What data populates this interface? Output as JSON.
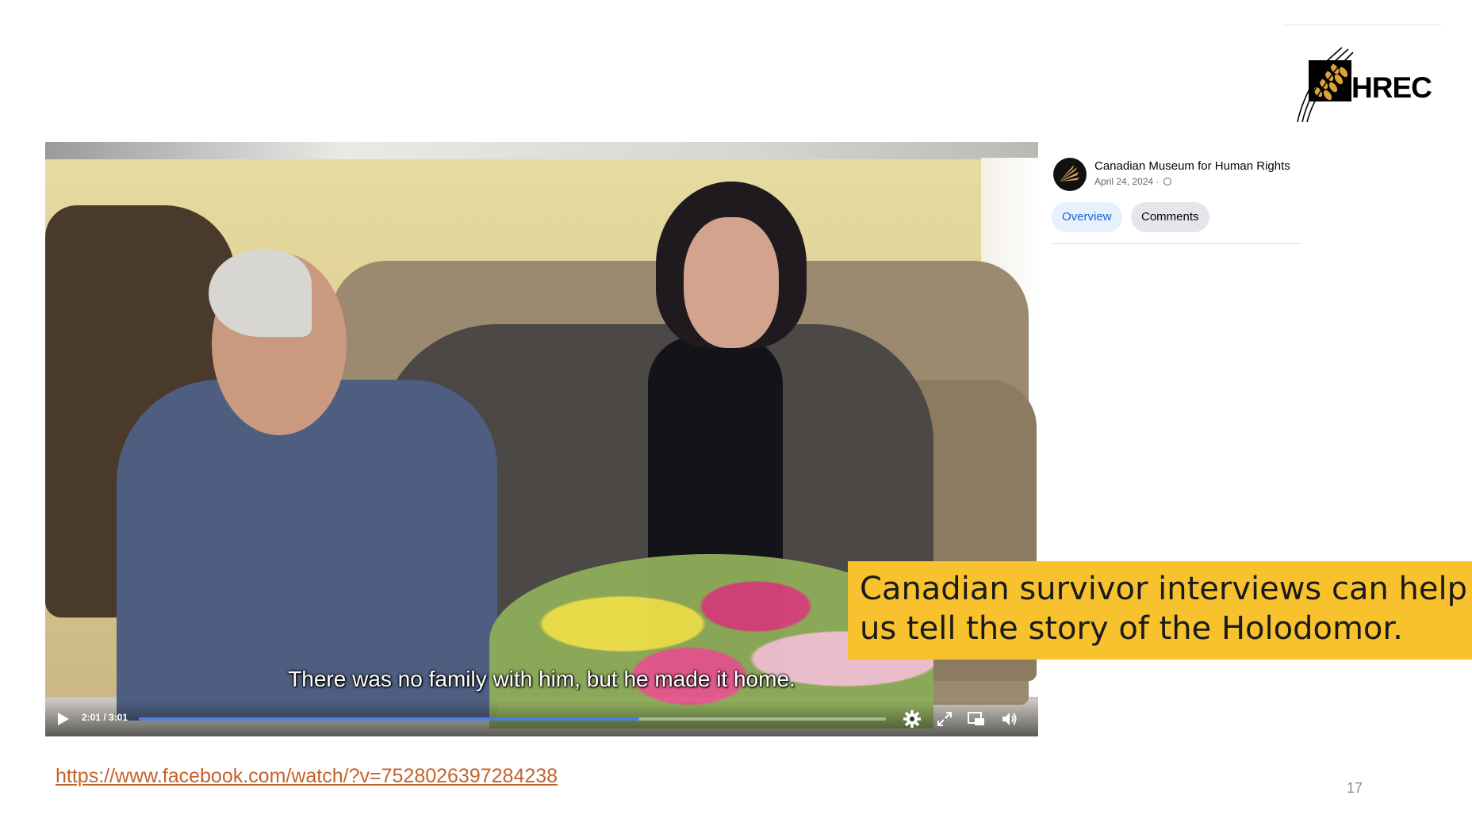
{
  "logo": {
    "text": "HREC"
  },
  "video": {
    "subtitle": "There was no family with him, but he made it home.",
    "time": "2:01 / 3:01",
    "progress_fraction": 0.67
  },
  "facebook": {
    "page_name": "Canadian Museum for Human Rights",
    "date": "April 24, 2024 ·",
    "tabs": [
      "Overview",
      "Comments"
    ]
  },
  "caption": {
    "line1": "Canadian survivor interviews can help",
    "line2": "us tell the story of the Holodomor."
  },
  "link": "https://www.facebook.com/watch/?v=752802639728423​8",
  "page_number": "17"
}
